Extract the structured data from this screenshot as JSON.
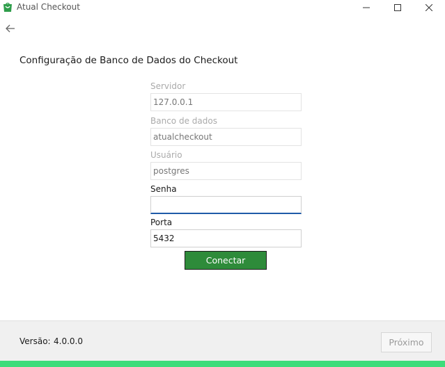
{
  "window": {
    "title": "Atual Checkout",
    "accent_color": "#2e8b3a"
  },
  "page": {
    "title": "Configuração de Banco de Dados do Checkout"
  },
  "form": {
    "server_label": "Servidor",
    "server_value": "127.0.0.1",
    "database_label": "Banco de dados",
    "database_value": "atualcheckout",
    "user_label": "Usuário",
    "user_value": "postgres",
    "password_label": "Senha",
    "password_value": "",
    "port_label": "Porta",
    "port_value": "5432",
    "connect_label": "Conectar"
  },
  "footer": {
    "version_label": "Versão:",
    "version_value": "4.0.0.0",
    "next_label": "Próximo"
  }
}
